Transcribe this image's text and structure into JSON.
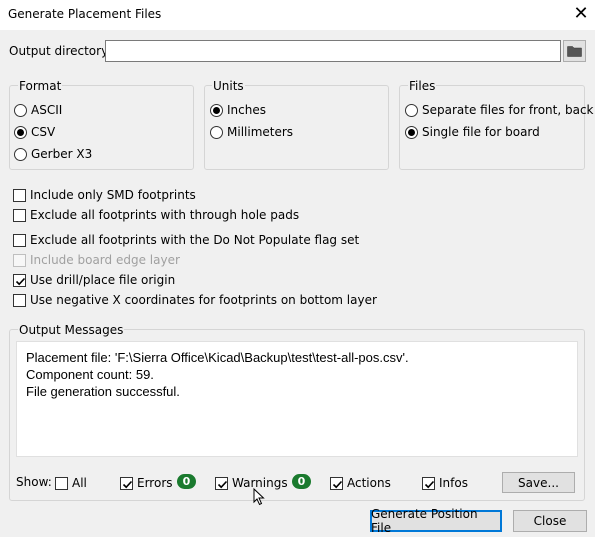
{
  "window": {
    "title": "Generate Placement Files",
    "close_label": "✕"
  },
  "output_directory": {
    "label": "Output directory:",
    "value": ""
  },
  "format": {
    "title": "Format",
    "options": [
      {
        "label": "ASCII",
        "selected": false
      },
      {
        "label": "CSV",
        "selected": true
      },
      {
        "label": "Gerber X3",
        "selected": false
      }
    ]
  },
  "units": {
    "title": "Units",
    "options": [
      {
        "label": "Inches",
        "selected": true
      },
      {
        "label": "Millimeters",
        "selected": false
      }
    ]
  },
  "files": {
    "title": "Files",
    "options": [
      {
        "label": "Separate files for front, back",
        "selected": false
      },
      {
        "label": "Single file for board",
        "selected": true
      }
    ]
  },
  "options": [
    {
      "label": "Include only SMD footprints",
      "checked": false,
      "enabled": true
    },
    {
      "label": "Exclude all footprints with through hole pads",
      "checked": false,
      "enabled": true
    },
    {
      "label": "Exclude all footprints with the Do Not Populate flag set",
      "checked": false,
      "enabled": true
    },
    {
      "label": "Include board edge layer",
      "checked": false,
      "enabled": false
    },
    {
      "label": "Use drill/place file origin",
      "checked": true,
      "enabled": true
    },
    {
      "label": "Use negative X coordinates for footprints on bottom layer",
      "checked": false,
      "enabled": true
    }
  ],
  "messages": {
    "title": "Output Messages",
    "lines": [
      "Placement file: 'F:\\Sierra Office\\Kicad\\Backup\\test\\test-all-pos.csv'.",
      "Component count: 59.",
      "File generation successful."
    ]
  },
  "filters": {
    "show_label": "Show:",
    "all": {
      "label": "All",
      "checked": false
    },
    "errors": {
      "label": "Errors",
      "checked": true,
      "count": "0"
    },
    "warnings": {
      "label": "Warnings",
      "checked": true,
      "count": "0"
    },
    "actions": {
      "label": "Actions",
      "checked": true
    },
    "infos": {
      "label": "Infos",
      "checked": true
    },
    "save_label": "Save..."
  },
  "buttons": {
    "generate": "Generate Position File",
    "close": "Close"
  },
  "colors": {
    "badge_green": "#1a7a2e",
    "default_button_border": "#0078d7"
  }
}
